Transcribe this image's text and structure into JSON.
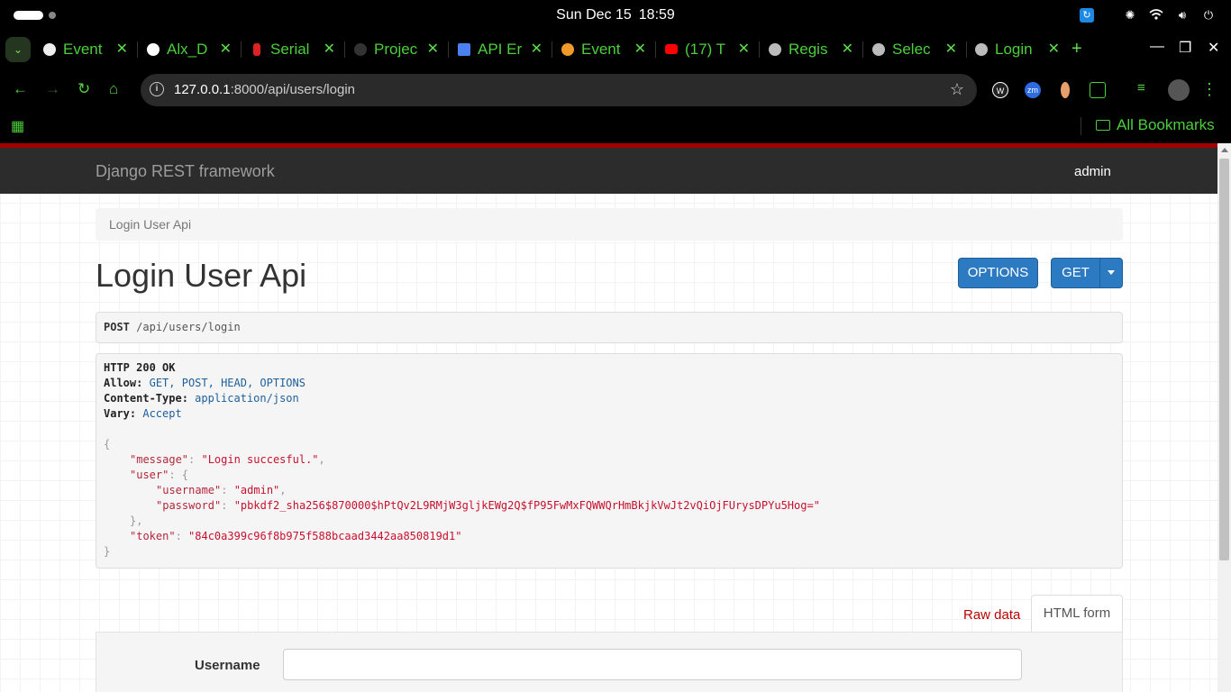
{
  "os": {
    "clock_date": "Sun Dec 15",
    "clock_time": "18:59"
  },
  "browser": {
    "tabs": [
      {
        "title": "Event",
        "active": false
      },
      {
        "title": "Alx_D",
        "active": false
      },
      {
        "title": "Serial",
        "active": false
      },
      {
        "title": "Projec",
        "active": false
      },
      {
        "title": "API Er",
        "active": false
      },
      {
        "title": "Event",
        "active": false
      },
      {
        "title": "(17) T",
        "active": false
      },
      {
        "title": "Regis",
        "active": false
      },
      {
        "title": "Selec",
        "active": false
      },
      {
        "title": "Login",
        "active": true
      }
    ],
    "close_glyph": "✕",
    "new_tab_glyph": "+",
    "url_host": "127.0.0.1",
    "url_rest": ":8000/api/users/login",
    "bookmarks_label": "All Bookmarks",
    "extensions": [
      "W",
      "zm",
      "",
      ""
    ]
  },
  "drf": {
    "brand": "Django REST framework",
    "user": "admin",
    "breadcrumb": "Login User Api",
    "title": "Login User Api",
    "options_label": "OPTIONS",
    "get_label": "GET",
    "request_method": "POST",
    "request_path": "/api/users/login",
    "response": {
      "status": "HTTP 200 OK",
      "headers": [
        {
          "key": "Allow:",
          "value": "GET, POST, HEAD, OPTIONS"
        },
        {
          "key": "Content-Type:",
          "value": "application/json"
        },
        {
          "key": "Vary:",
          "value": "Accept"
        }
      ],
      "json": {
        "message_key": "\"message\"",
        "message_val": "\"Login succesful.\"",
        "user_key": "\"user\"",
        "username_key": "\"username\"",
        "username_val": "\"admin\"",
        "password_key": "\"password\"",
        "password_val": "\"pbkdf2_sha256$870000$hPtQv2L9RMjW3gljkEWg2Q$fP95FwMxFQWWQrHmBkjkVwJt2vQiOjFUrysDPYu5Hog=\"",
        "token_key": "\"token\"",
        "token_val": "\"84c0a399c96f8b975f588bcaad3442aa850819d1\""
      }
    },
    "tab_raw": "Raw data",
    "tab_html": "HTML form",
    "username_label": "Username",
    "username_value": ""
  },
  "colors": {
    "accent_green": "#4ccf3b",
    "drf_red": "#a30000",
    "drf_blue": "#2c7ac1"
  }
}
